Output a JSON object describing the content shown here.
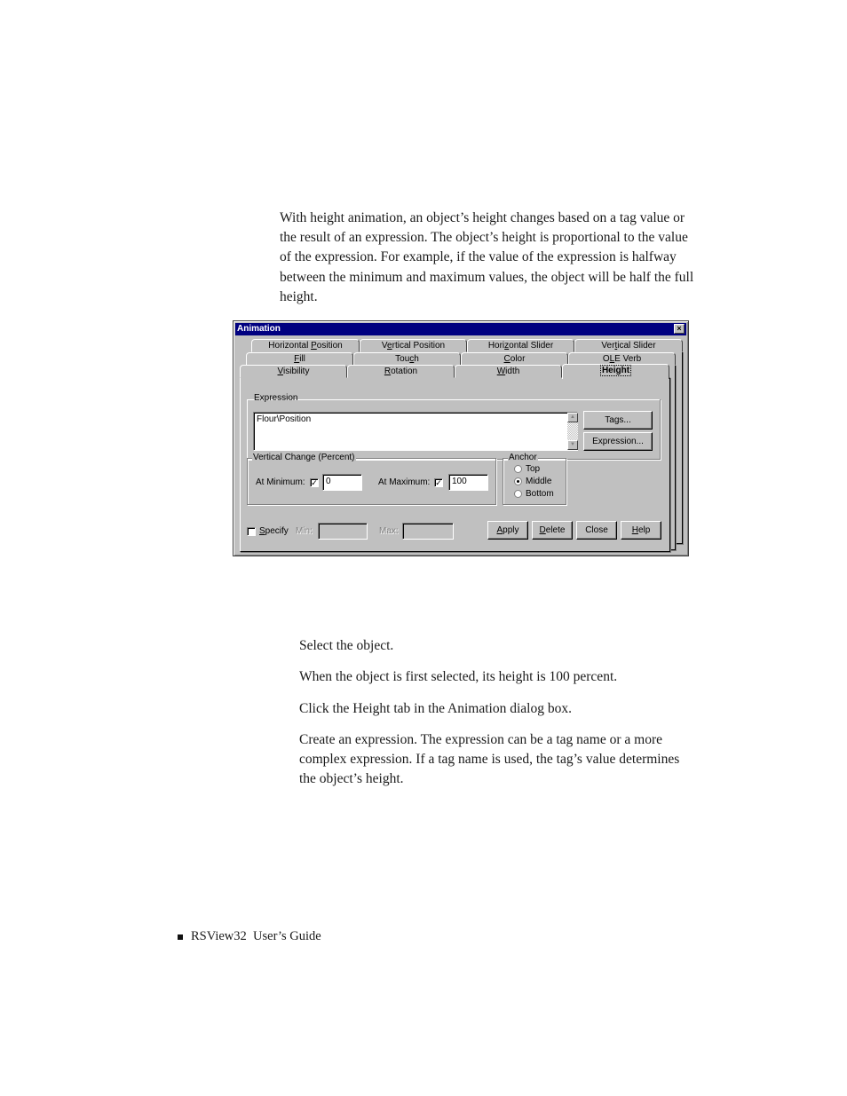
{
  "intro": {
    "text": "With height animation, an object’s height changes based on a tag value or the result of an expression. The object’s height is proportional to the value of the expression. For example, if the value of the expression is halfway between the minimum and maximum values, the object will be half the full height."
  },
  "dialog": {
    "title": "Animation",
    "close_icon": "×",
    "tabs_row1": [
      {
        "pre": "Horizontal ",
        "u": "P",
        "post": "osition"
      },
      {
        "pre": "V",
        "u": "e",
        "post": "rtical Position"
      },
      {
        "pre": "Hori",
        "u": "z",
        "post": "ontal Slider"
      },
      {
        "pre": "Ver",
        "u": "t",
        "post": "ical Slider"
      }
    ],
    "tabs_row2": [
      {
        "pre": "",
        "u": "F",
        "post": "ill"
      },
      {
        "pre": "Tou",
        "u": "c",
        "post": "h"
      },
      {
        "pre": "",
        "u": "C",
        "post": "olor"
      },
      {
        "pre": "O",
        "u": "L",
        "post": "E Verb"
      }
    ],
    "tabs_row3": [
      {
        "pre": "",
        "u": "V",
        "post": "isibility"
      },
      {
        "pre": "",
        "u": "R",
        "post": "otation"
      },
      {
        "pre": "",
        "u": "W",
        "post": "idth"
      },
      {
        "pre": "",
        "u": "",
        "post": "Height"
      }
    ],
    "active_tab": "Height",
    "expression_label": "Expression",
    "expression_value": "Flour\\Position",
    "tags_button": "Tags...",
    "expression_button": "Expression...",
    "vertical_change": {
      "label": "Vertical Change (Percent)",
      "at_minimum_label": "At Minimum:",
      "at_minimum_checked": true,
      "at_minimum_value": "0",
      "at_maximum_label": "At Maximum:",
      "at_maximum_checked": true,
      "at_maximum_value": "100"
    },
    "anchor": {
      "label": "Anchor",
      "options": [
        "Top",
        "Middle",
        "Bottom"
      ],
      "selected": "Middle"
    },
    "specify": {
      "pre": "",
      "u": "S",
      "post": "pecify",
      "checked": false
    },
    "min_label": "Min:",
    "max_label": "Max:",
    "buttons": [
      {
        "pre": "",
        "u": "A",
        "post": "pply"
      },
      {
        "pre": "",
        "u": "D",
        "post": "elete"
      },
      {
        "pre": "",
        "u": "",
        "post": "Close"
      },
      {
        "pre": "",
        "u": "H",
        "post": "elp"
      }
    ],
    "check_mark": "✓"
  },
  "steps": [
    "Select the object.",
    "When the object is first selected, its height is 100 percent.",
    "Click the Height tab in the Animation dialog box.",
    "Create an expression. The expression can be a tag name or a more complex expression. If a tag name is used, the tag’s value determines the object’s height."
  ],
  "footer": {
    "text": "RSView32  User’s Guide"
  }
}
